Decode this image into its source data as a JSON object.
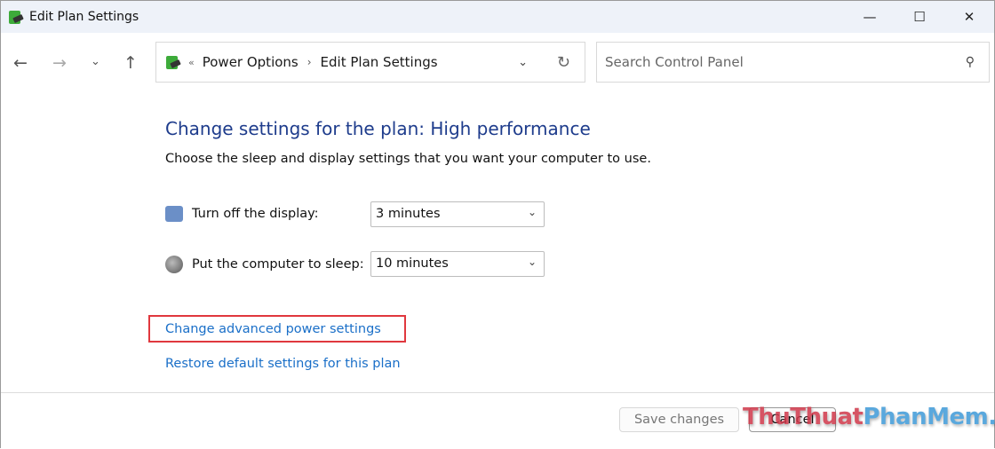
{
  "window": {
    "title": "Edit Plan Settings"
  },
  "address": {
    "breadcrumbs": [
      "Power Options",
      "Edit Plan Settings"
    ]
  },
  "search": {
    "placeholder": "Search Control Panel"
  },
  "main": {
    "heading": "Change settings for the plan: High performance",
    "subtitle": "Choose the sleep and display settings that you want your computer to use.",
    "display": {
      "label": "Turn off the display:",
      "value": "3 minutes"
    },
    "sleep": {
      "label": "Put the computer to sleep:",
      "value": "10 minutes"
    },
    "advanced_link": "Change advanced power settings",
    "restore_link": "Restore default settings for this plan"
  },
  "footer": {
    "save": "Save changes",
    "cancel": "Cancel"
  },
  "watermark": {
    "part1": "ThuThuat",
    "part2": "PhanMem.vn"
  }
}
